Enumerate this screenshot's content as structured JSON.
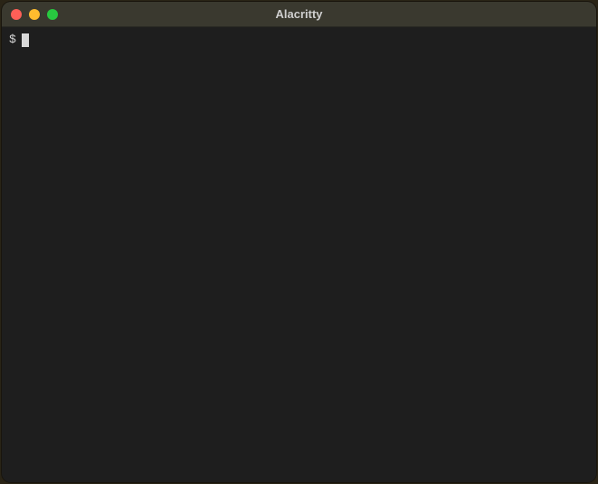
{
  "window": {
    "title": "Alacritty"
  },
  "terminal": {
    "prompt": "$"
  }
}
